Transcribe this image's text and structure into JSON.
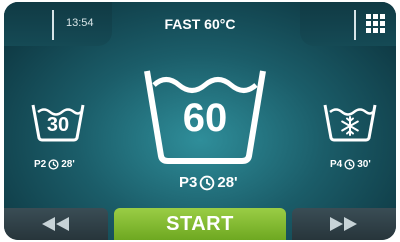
{
  "header": {
    "time": "13:54",
    "program_title": "FAST 60°C",
    "menu_icon": "grid-menu-icon"
  },
  "programs": {
    "left": {
      "temp": "30",
      "program": "P2",
      "duration": "28'",
      "icon": "clock-icon"
    },
    "center": {
      "temp": "60",
      "program": "P3",
      "duration": "28'",
      "icon": "clock-icon"
    },
    "right": {
      "program": "P4",
      "duration": "30'",
      "icon": "snowflake-icon"
    }
  },
  "footer": {
    "start_label": "START",
    "prev_icon": "rewind-icon",
    "next_icon": "fast-forward-icon"
  },
  "colors": {
    "accent_green": "#86bf34",
    "background_teal": "#1b5d69"
  }
}
